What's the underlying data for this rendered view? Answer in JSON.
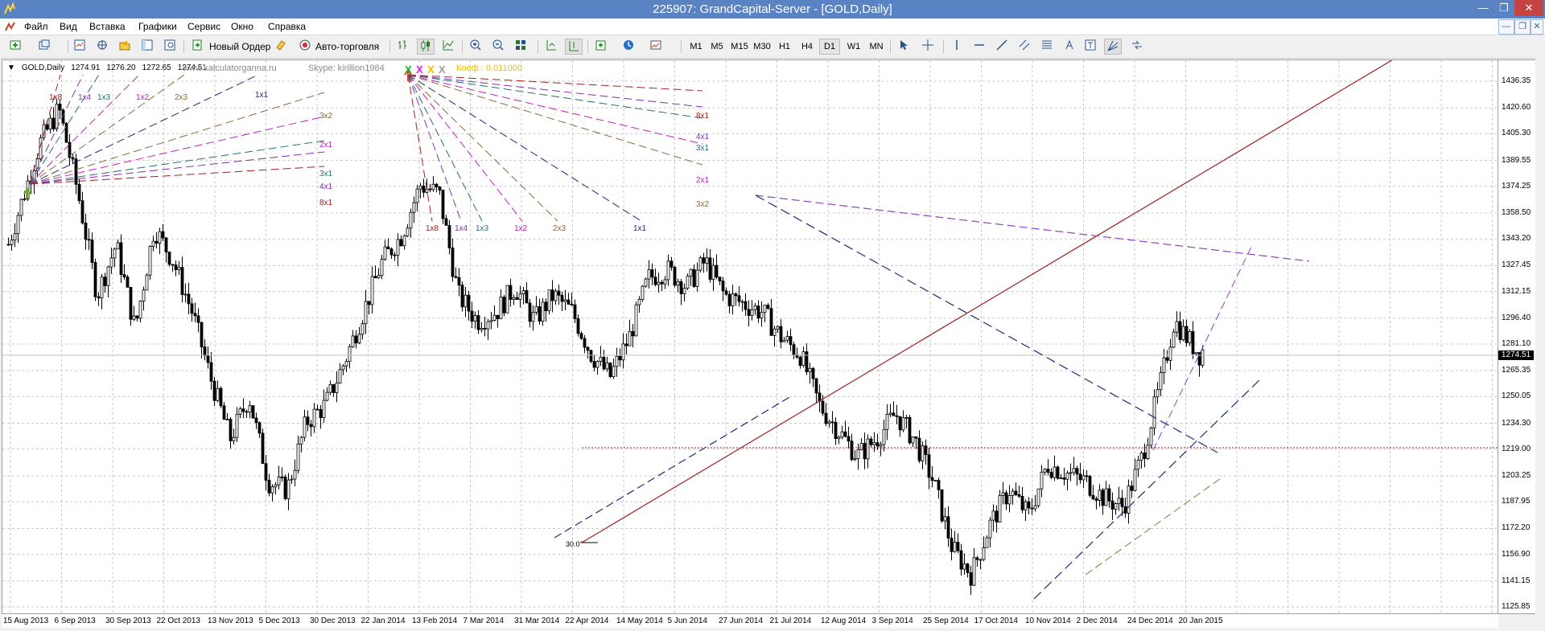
{
  "window": {
    "title": "225907: GrandCapital-Server - [GOLD,Daily]"
  },
  "menu": {
    "items": [
      "Файл",
      "Вид",
      "Вставка",
      "Графики",
      "Сервис",
      "Окно",
      "Справка"
    ]
  },
  "toolbar": {
    "new_order": "Новый Ордер",
    "auto_trading": "Авто-торговля",
    "timeframes": [
      "M1",
      "M5",
      "M15",
      "M30",
      "H1",
      "H4",
      "D1",
      "W1",
      "MN"
    ],
    "active_timeframe": "D1"
  },
  "search": {
    "placeholder": ""
  },
  "chart": {
    "symbol": "GOLD,Daily",
    "ohlc": [
      "1274.91",
      "1276.20",
      "1272.65",
      "1274.51"
    ],
    "watermark_site": "www.kalculatorganna.ru",
    "watermark_skype": "Skype: kirillion1984",
    "markers": [
      "X",
      "X",
      "X",
      "X"
    ],
    "marker_colors": [
      "#1fae1f",
      "#e020e0",
      "#e8c000",
      "#9a9a9a"
    ],
    "coef": "Коеф.:  0.011000",
    "current_price": "1274.51",
    "angle_label": "30.0°",
    "y_ticks": [
      "1436.35",
      "1420.60",
      "1405.30",
      "1389.55",
      "1374.25",
      "1358.50",
      "1343.20",
      "1327.45",
      "1312.15",
      "1296.40",
      "1281.10",
      "1265.35",
      "1250.05",
      "1234.30",
      "1219.00",
      "1203.25",
      "1187.95",
      "1172.20",
      "1156.90",
      "1141.15",
      "1125.85"
    ],
    "x_ticks": [
      "15 Aug 2013",
      "6 Sep 2013",
      "30 Sep 2013",
      "22 Oct 2013",
      "13 Nov 2013",
      "5 Dec 2013",
      "30 Dec 2013",
      "22 Jan 2014",
      "13 Feb 2014",
      "7 Mar 2014",
      "31 Mar 2014",
      "22 Apr 2014",
      "14 May 2014",
      "5 Jun 2014",
      "27 Jun 2014",
      "21 Jul 2014",
      "12 Aug 2014",
      "3 Sep 2014",
      "25 Sep 2014",
      "17 Oct 2014",
      "10 Nov 2014",
      "2 Dec 2014",
      "24 Dec 2014",
      "20 Jan 2015"
    ],
    "fan1_labels": [
      "1x8",
      "1x4",
      "1x3",
      "1x2",
      "2x3",
      "1x1",
      "3x2",
      "2x1",
      "3x1",
      "4x1",
      "8x1"
    ],
    "fan2_labels": [
      "8x1",
      "4x1",
      "3x1",
      "2x1",
      "3x2",
      "1x8",
      "1x4",
      "1x3",
      "1x2",
      "2x3",
      "1x1"
    ]
  },
  "colors": {
    "titlebar": "#5a83c3",
    "candle": "#000000",
    "price_line": "#c0c0c0"
  }
}
